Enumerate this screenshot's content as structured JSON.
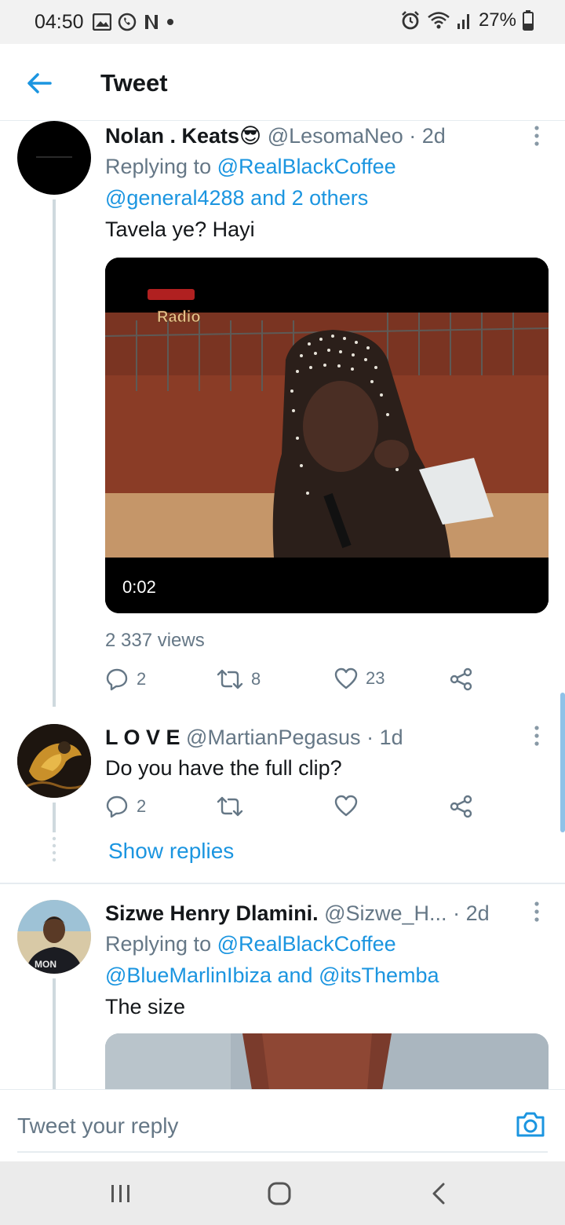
{
  "status_bar": {
    "time": "04:50",
    "battery": "27%",
    "icons_left": [
      "gallery-icon",
      "whatsapp-icon",
      "netflix-icon",
      "dot-icon"
    ],
    "icons_right": [
      "alarm-icon",
      "wifi-icon",
      "signal-icon",
      "battery-icon"
    ]
  },
  "header": {
    "title": "Tweet",
    "back_icon": "arrow-left-icon",
    "accent": "#1b95e0"
  },
  "tweets": [
    {
      "name": "Nolan . Keats",
      "emoji": "😎",
      "handle": "@LesomaNeo",
      "time": "· 2d",
      "replying_prefix": "Replying to",
      "reply_to_1": "@RealBlackCoffee",
      "reply_to_2": "@general4288",
      "reply_to_join": "and",
      "reply_to_3": "2 others",
      "text": "Tavela ye? Hayi",
      "video_time": "0:02",
      "watermark": "Radio",
      "views": "2 337 views",
      "replies": "2",
      "retweets": "8",
      "likes": "23"
    },
    {
      "name": "L O V E",
      "handle": "@MartianPegasus",
      "time": "· 1d",
      "text": "Do you have the full clip?",
      "replies": "2",
      "show_replies": "Show replies"
    },
    {
      "name": "Sizwe Henry Dlamini.",
      "handle": "@Sizwe_H...",
      "time": "· 2d",
      "replying_prefix": "Replying to",
      "reply_to_1": "@RealBlackCoffee",
      "reply_to_2": "@BlueMarlinIbiza",
      "reply_to_join": "and",
      "reply_to_3": "@itsThemba",
      "text": "The size",
      "avatar_shirt_text": "MON"
    }
  ],
  "composer": {
    "placeholder": "Tweet your reply",
    "camera_icon": "camera-icon"
  },
  "navbar": {
    "icons": [
      "recent-apps-icon",
      "home-icon",
      "back-icon"
    ]
  }
}
